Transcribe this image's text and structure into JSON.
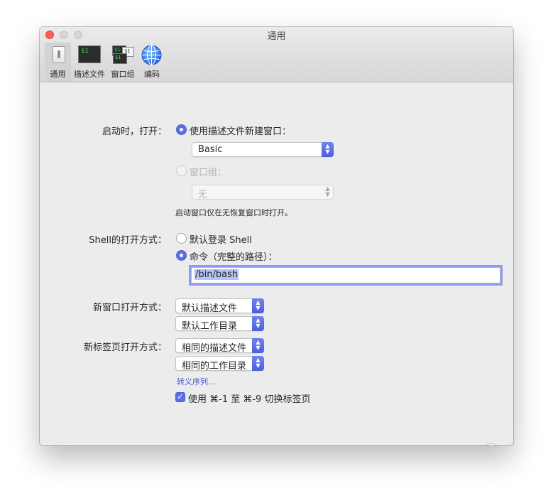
{
  "window": {
    "title": "通用"
  },
  "toolbar": {
    "items": [
      {
        "label": "通用",
        "selected": true,
        "icon": "light-switch-icon"
      },
      {
        "label": "描述文件",
        "selected": false,
        "icon": "terminal-profile-icon",
        "icon_text": "$1"
      },
      {
        "label": "窗口组",
        "selected": false,
        "icon": "window-group-icon",
        "icon_text_a": "$1",
        "icon_text_b": "$1"
      },
      {
        "label": "编码",
        "selected": false,
        "icon": "globe-icon"
      }
    ]
  },
  "startup": {
    "label": "启动时，打开：",
    "option_profile_label": "使用描述文件新建窗口：",
    "profile_value": "Basic",
    "option_group_label": "窗口组：",
    "group_value": "无",
    "note": "启动窗口仅在无恢复窗口时打开。"
  },
  "shell": {
    "label": "Shell的打开方式：",
    "option_default_label": "默认登录 Shell",
    "option_command_label": "命令（完整的路径）：",
    "command_value": "/bin/bash"
  },
  "new_window": {
    "label": "新窗口打开方式：",
    "profile_value": "默认描述文件",
    "dir_value": "默认工作目录"
  },
  "new_tab": {
    "label": "新标签页打开方式：",
    "profile_value": "相同的描述文件",
    "dir_value": "相同的工作目录"
  },
  "escape_link": "转义序列...",
  "switch_tabs": {
    "label": "使用 ⌘-1 至 ⌘-9 切换标签页",
    "checked": true
  },
  "help_label": "?",
  "colors": {
    "accent": "#5b6ee8",
    "close": "#fd5f57",
    "link": "#3b55d8"
  }
}
